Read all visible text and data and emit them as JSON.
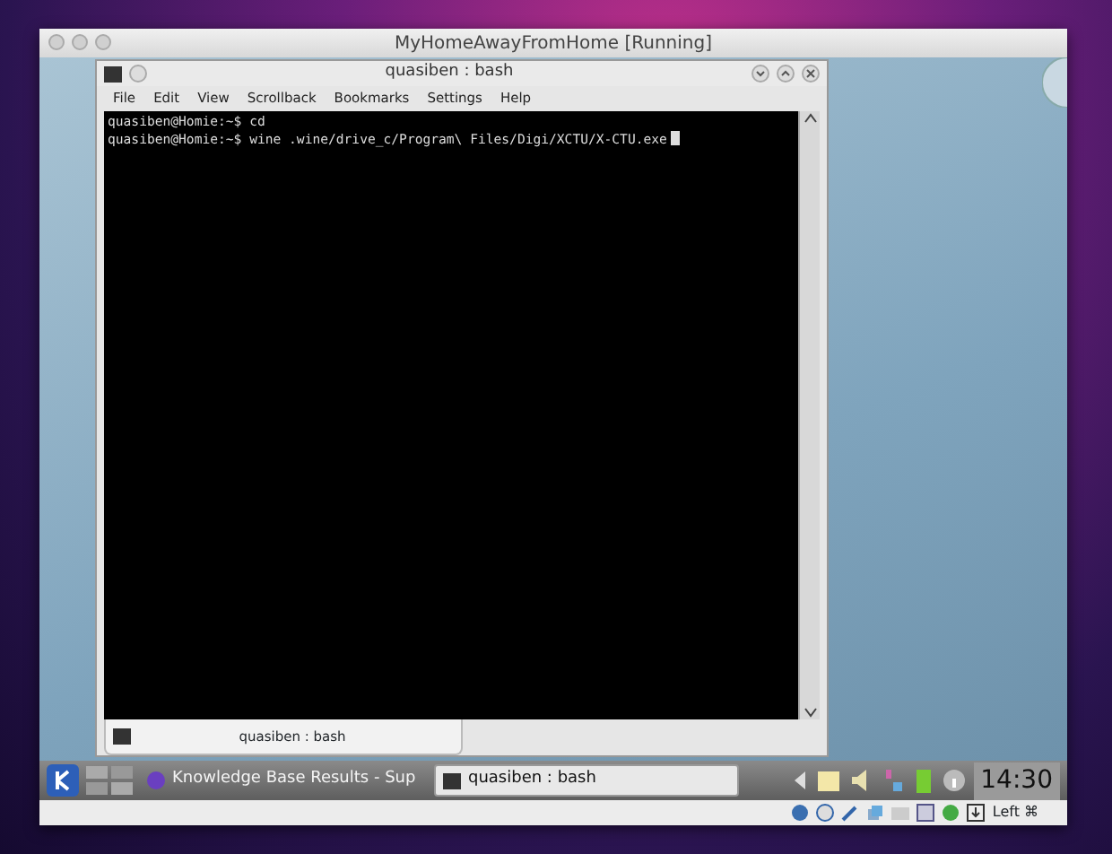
{
  "host_window": {
    "title": "MyHomeAwayFromHome [Running]"
  },
  "konsole": {
    "title": "quasiben : bash",
    "menu": [
      "File",
      "Edit",
      "View",
      "Scrollback",
      "Bookmarks",
      "Settings",
      "Help"
    ],
    "lines": [
      "quasiben@Homie:~$ cd",
      "quasiben@Homie:~$ wine .wine/drive_c/Program\\ Files/Digi/XCTU/X-CTU.exe"
    ],
    "tabs": [
      {
        "label": "quasiben : bash",
        "selected": true
      }
    ]
  },
  "taskbar": {
    "tasks": [
      {
        "label": "Knowledge Base Results - Sup",
        "selected": false
      },
      {
        "label": "quasiben : bash",
        "selected": true
      }
    ],
    "clock": "14:30"
  },
  "status_bar": {
    "host_key": "Left ⌘"
  }
}
